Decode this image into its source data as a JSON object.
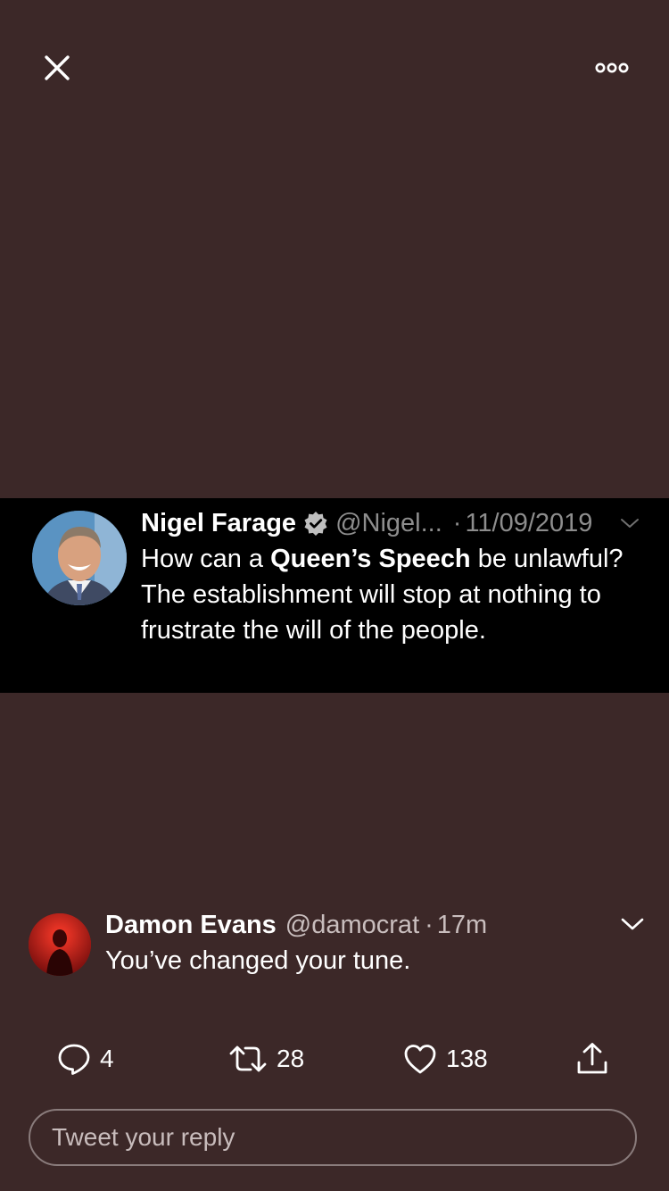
{
  "icons": {
    "close": "close-icon",
    "more": "more-icon",
    "verified": "verified-badge-icon",
    "caret": "chevron-down-icon",
    "reply": "reply-icon",
    "retweet": "retweet-icon",
    "like": "heart-icon",
    "share": "share-icon"
  },
  "media_tweet": {
    "name": "Nigel Farage",
    "handle": "@Nigel...",
    "separator": "·",
    "date": "11/09/2019",
    "text_prefix": "How can a ",
    "text_bold": "Queen’s Speech",
    "text_suffix": " be unlawful? The establishment will stop at nothing to frustrate the will of the people."
  },
  "reply_tweet": {
    "name": "Damon Evans",
    "handle": "@damocrat",
    "separator": "·",
    "time": "17m",
    "text": "You’ve changed your tune."
  },
  "actions": {
    "replies": "4",
    "retweets": "28",
    "likes": "138"
  },
  "composer": {
    "placeholder": "Tweet your reply"
  },
  "colors": {
    "background": "#3c2828",
    "media_band": "#000000",
    "muted_text": "#8d8d8d"
  }
}
